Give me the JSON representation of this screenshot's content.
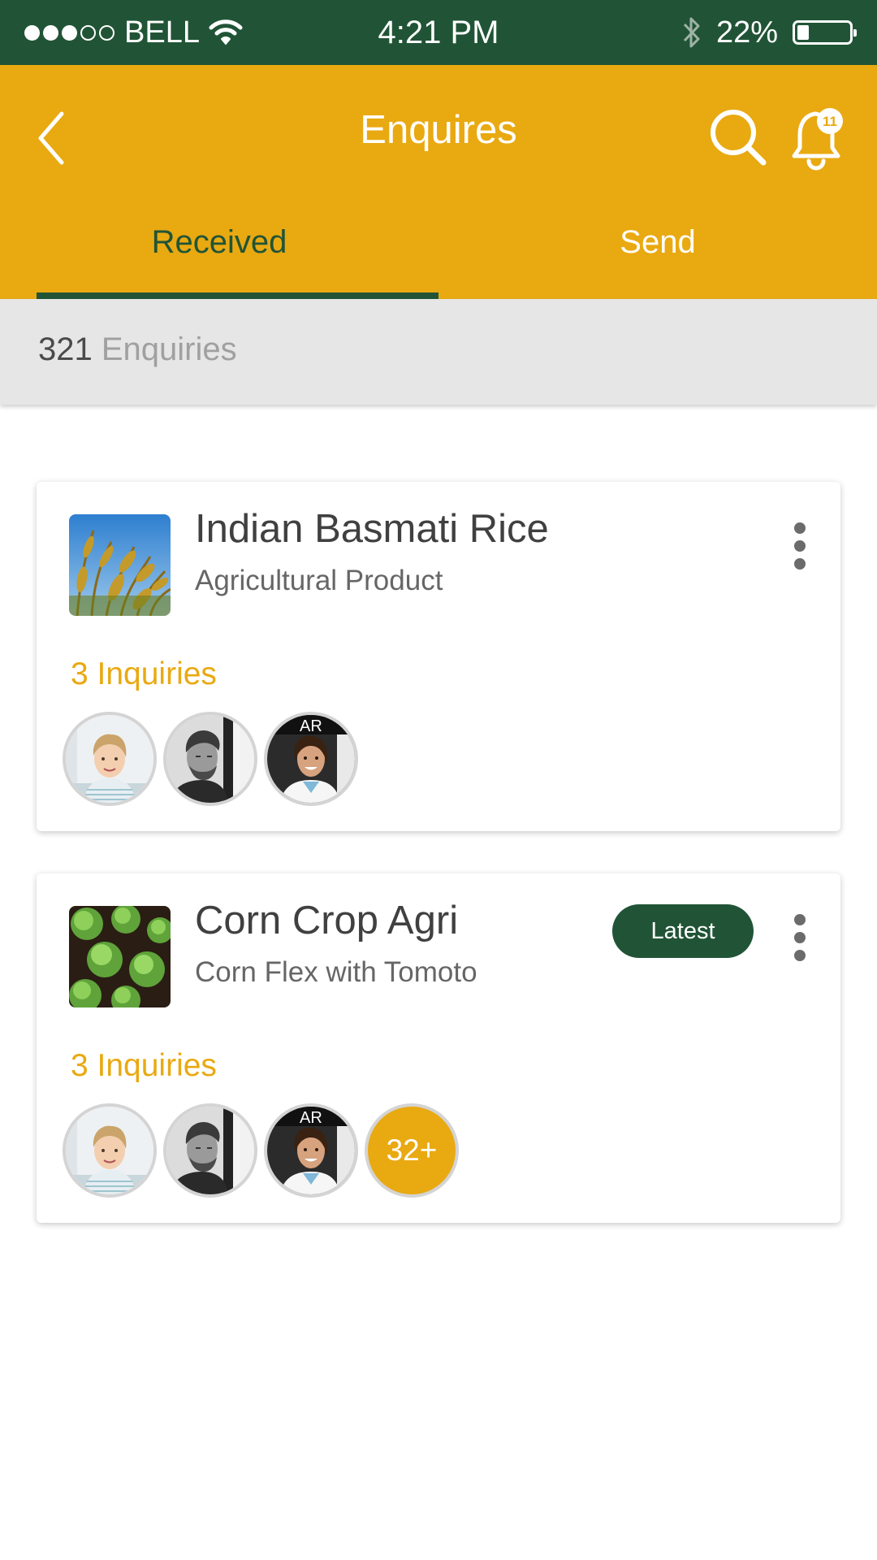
{
  "status_bar": {
    "carrier": "BELL",
    "time": "4:21 PM",
    "battery": "22%",
    "battery_level": 0.22,
    "signal_bars": 3,
    "signal_total": 5
  },
  "header": {
    "title": "Enquires",
    "notification_count": "11",
    "icons": [
      "back-chevron-icon",
      "search-icon",
      "bell-icon"
    ]
  },
  "tabs": [
    {
      "label": "Received",
      "active": true
    },
    {
      "label": "Send",
      "active": false
    }
  ],
  "summary": {
    "count": "321",
    "label": "Enquiries"
  },
  "enquiries": [
    {
      "title": "Indian Basmati Rice",
      "subtitle": "Agricultural Product",
      "inquiries_label": "3 Inquiries",
      "badge": "",
      "more_count": ""
    },
    {
      "title": "Corn Crop Agri",
      "subtitle": "Corn Flex with Tomoto",
      "inquiries_label": "3 Inquiries",
      "badge": "Latest",
      "more_count": "32+"
    }
  ],
  "colors": {
    "primary_green": "#215436",
    "accent_yellow": "#E9A911",
    "count_bar_bg": "#E6E6E6"
  }
}
